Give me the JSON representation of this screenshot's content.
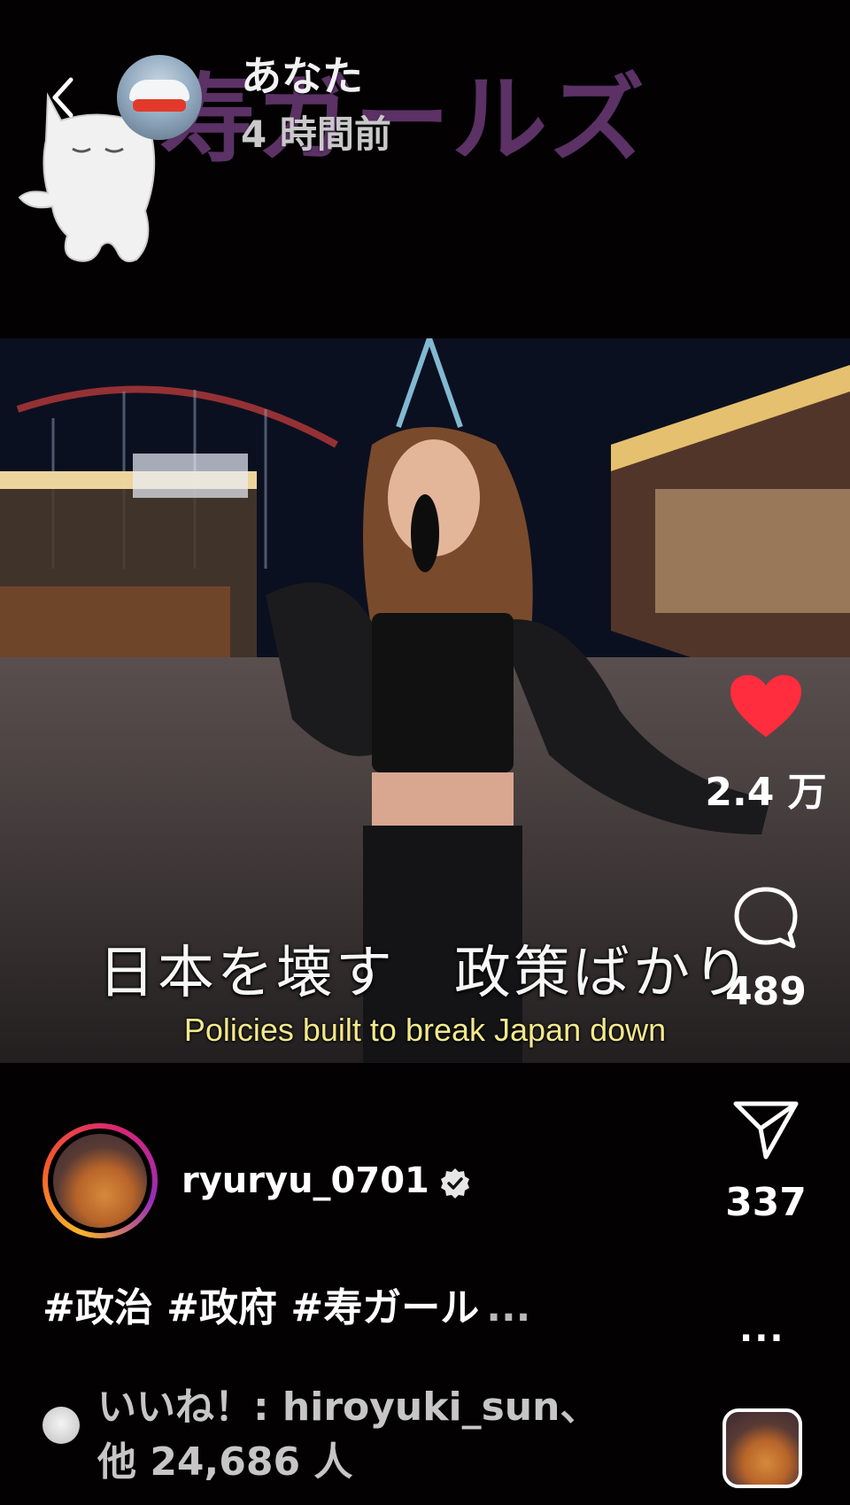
{
  "header": {
    "back_icon": "chevron-left-icon",
    "background_title": "寿ガールズ",
    "username": "あなた",
    "time_ago": "4 時間前"
  },
  "video": {
    "subtitle_jp": "日本を壊す　政策ばかり",
    "subtitle_en": "Policies built to break Japan down"
  },
  "actions": {
    "like": {
      "icon": "heart-icon",
      "count": "2.4 万",
      "color": "#ff2d3d"
    },
    "comment": {
      "icon": "comment-icon",
      "count": "489"
    },
    "share": {
      "icon": "paper-plane-icon",
      "count": "337"
    },
    "more": "..."
  },
  "author": {
    "username": "ryuryu_0701",
    "verified_icon": "verified-badge-icon"
  },
  "caption": {
    "text": "#政治 #政府 #寿ガール",
    "more": "..."
  },
  "likes": {
    "line1": "いいね！: hiroyuki_sun、",
    "line2": "他 24,686 人"
  }
}
